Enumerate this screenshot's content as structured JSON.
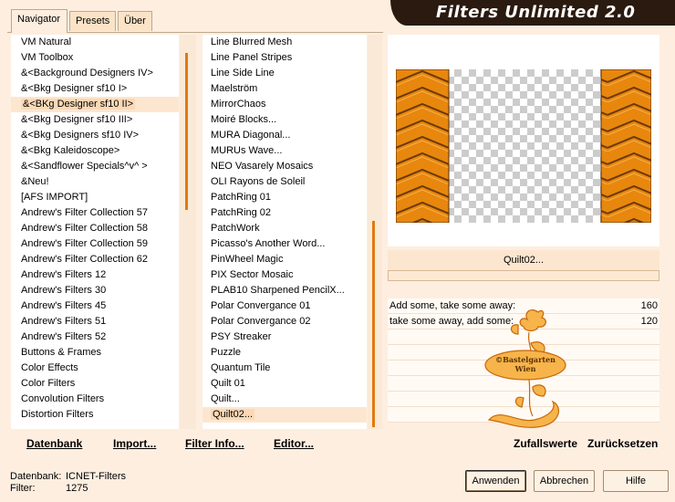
{
  "title": "Filters Unlimited 2.0",
  "tabs": [
    "Navigator",
    "Presets",
    "Über"
  ],
  "categories": [
    "VM Natural",
    "VM Toolbox",
    "&<Background Designers IV>",
    "&<Bkg Designer sf10 I>",
    "&<BKg Designer sf10 II>",
    "&<Bkg Designer sf10 III>",
    "&<Bkg Designers sf10 IV>",
    "&<Bkg Kaleidoscope>",
    "&<Sandflower Specials^v^ >",
    "&Neu!",
    "[AFS IMPORT]",
    "Andrew's Filter Collection 57",
    "Andrew's Filter Collection 58",
    "Andrew's Filter Collection 59",
    "Andrew's Filter Collection 62",
    "Andrew's Filters 12",
    "Andrew's Filters 30",
    "Andrew's Filters 45",
    "Andrew's Filters 51",
    "Andrew's Filters 52",
    "Buttons & Frames",
    "Color Effects",
    "Color Filters",
    "Convolution Filters",
    "Distortion Filters"
  ],
  "selected_category_index": 4,
  "filters": [
    "Line Blurred Mesh",
    "Line Panel Stripes",
    "Line Side Line",
    "Maelström",
    "MirrorChaos",
    "Moiré Blocks...",
    "MURA Diagonal...",
    "MURUs Wave...",
    "NEO Vasarely Mosaics",
    "OLI Rayons de Soleil",
    "PatchRing 01",
    "PatchRing 02",
    "PatchWork",
    "Picasso's Another Word...",
    "PinWheel Magic",
    "PIX Sector Mosaic",
    "PLAB10 Sharpened PencilX...",
    "Polar Convergance 01",
    "Polar Convergance 02",
    "PSY Streaker",
    "Puzzle",
    "Quantum Tile",
    "Quilt 01",
    "Quilt...",
    "Quilt02..."
  ],
  "selected_filter_index": 24,
  "toolbar": {
    "database": "Datenbank",
    "import": "Import...",
    "filter_info": "Filter Info...",
    "editor": "Editor..."
  },
  "preview": {
    "filter_name": "Quilt02..."
  },
  "parameters": [
    {
      "label": "Add some, take some away:",
      "value": "160"
    },
    {
      "label": "take some away, add some:",
      "value": "120"
    }
  ],
  "watermark_text": [
    "©Bastelgarten",
    "Wien"
  ],
  "actions": {
    "randomize": "Zufallswerte",
    "reset": "Zurücksetzen"
  },
  "status": {
    "db_label": "Datenbank:",
    "db_value": "ICNET-Filters",
    "filter_label": "Filter:",
    "filter_value": "1275"
  },
  "buttons": {
    "apply": "Anwenden",
    "cancel": "Abbrechen",
    "help": "Hilfe"
  },
  "colors": {
    "accent": "#e8870e",
    "banner": "#2a1a10",
    "background": "#fdeee0"
  }
}
